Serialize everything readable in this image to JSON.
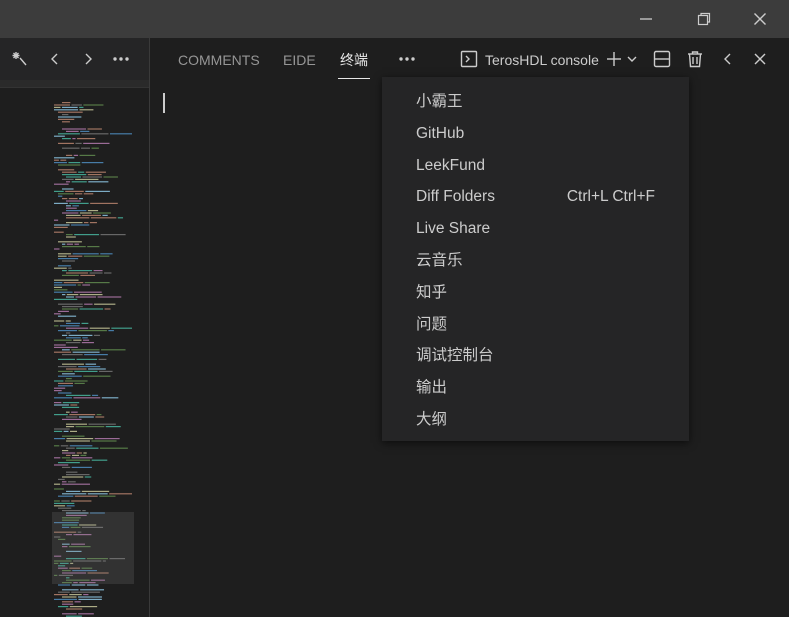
{
  "titlebar": {
    "buttons": [
      {
        "name": "minimize-icon"
      },
      {
        "name": "restore-icon"
      },
      {
        "name": "close-icon"
      }
    ]
  },
  "left_toolbar": {
    "icons": [
      "sparkle-chat-icon",
      "chevron-left-icon",
      "chevron-right-icon",
      "more-icon"
    ]
  },
  "panel": {
    "tabs": [
      {
        "label": "COMMENTS",
        "active": false
      },
      {
        "label": "EIDE",
        "active": false
      },
      {
        "label": "终端",
        "active": true
      }
    ],
    "more_label": "···",
    "terminal_name": "TerosHDL console",
    "actions": [
      "terminal-icon",
      "add-icon",
      "chevron-down-icon",
      "split-icon",
      "trash-icon",
      "chevron-left-icon",
      "close-icon"
    ]
  },
  "menu": {
    "items": [
      {
        "label": "小霸王",
        "shortcut": ""
      },
      {
        "label": "GitHub",
        "shortcut": ""
      },
      {
        "label": "LeekFund",
        "shortcut": ""
      },
      {
        "label": "Diff Folders",
        "shortcut": "Ctrl+L Ctrl+F"
      },
      {
        "label": "Live Share",
        "shortcut": ""
      },
      {
        "label": "云音乐",
        "shortcut": ""
      },
      {
        "label": "知乎",
        "shortcut": ""
      },
      {
        "label": "问题",
        "shortcut": ""
      },
      {
        "label": "调试控制台",
        "shortcut": ""
      },
      {
        "label": "输出",
        "shortcut": ""
      },
      {
        "label": "大纲",
        "shortcut": ""
      }
    ]
  },
  "colors": {
    "titlebar": "#3c3c3c",
    "editor_bg": "#1e1e1e",
    "menu_bg": "#252526",
    "text": "#cccccc",
    "inactive_tab": "#969696"
  }
}
